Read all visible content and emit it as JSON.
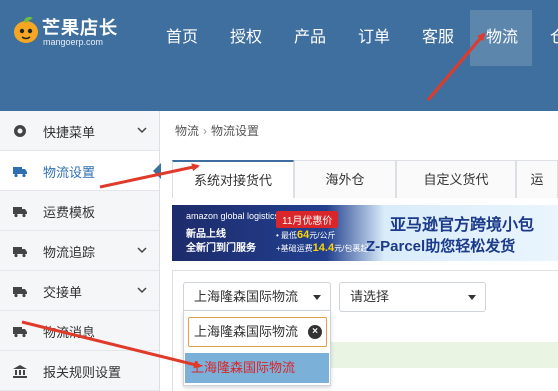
{
  "header": {
    "logo": {
      "brand": "芒果店长",
      "domain": "mangoerp.com"
    },
    "nav": [
      {
        "label": "首页"
      },
      {
        "label": "授权"
      },
      {
        "label": "产品"
      },
      {
        "label": "订单"
      },
      {
        "label": "客服"
      },
      {
        "label": "物流"
      },
      {
        "label": "仓"
      }
    ],
    "active_nav": "物流"
  },
  "sidebar": {
    "items": [
      {
        "label": "快捷菜单",
        "icon": "gear-icon",
        "expandable": true
      },
      {
        "label": "物流设置",
        "icon": "truck-icon",
        "expandable": false,
        "active": true
      },
      {
        "label": "运费模板",
        "icon": "truck-icon",
        "expandable": false
      },
      {
        "label": "物流追踪",
        "icon": "truck-icon",
        "expandable": true
      },
      {
        "label": "交接单",
        "icon": "truck-icon",
        "expandable": true
      },
      {
        "label": "物流消息",
        "icon": "truck-icon",
        "expandable": false
      },
      {
        "label": "报关规则设置",
        "icon": "bank-icon",
        "expandable": false
      }
    ]
  },
  "breadcrumb": {
    "root": "物流",
    "sep": "›",
    "current": "物流设置"
  },
  "tabs": [
    {
      "label": "系统对接货代",
      "active": true
    },
    {
      "label": "海外仓"
    },
    {
      "label": "自定义货代"
    },
    {
      "label": "运"
    }
  ],
  "banner": {
    "brand": "amazon global logistics",
    "line1": "新品上线",
    "line2": "全新门到门服务",
    "badge": "11月优惠价",
    "price_line1_pre": "• 最低",
    "price_line1_val": "64",
    "price_line1_post": "元/公斤",
    "price_line2_pre": "+基础运费",
    "price_line2_val": "14.4",
    "price_line2_post": "元/包裹起",
    "headline1": "亚马逊官方跨境小包",
    "headline2": "Z-Parcel助您轻松发货"
  },
  "filters": {
    "carrier_select": "上海隆森国际物流",
    "second_select": "请选择",
    "dropdown": {
      "search_value": "上海隆森国际物流",
      "clear_icon": "×",
      "options": [
        "上海隆森国际物流"
      ]
    }
  },
  "colors": {
    "header_bg": "#3f6f9e",
    "arrow": "#e03a2a",
    "highlight_option_bg": "#7bb0d8",
    "highlight_option_text": "#d9262a"
  }
}
